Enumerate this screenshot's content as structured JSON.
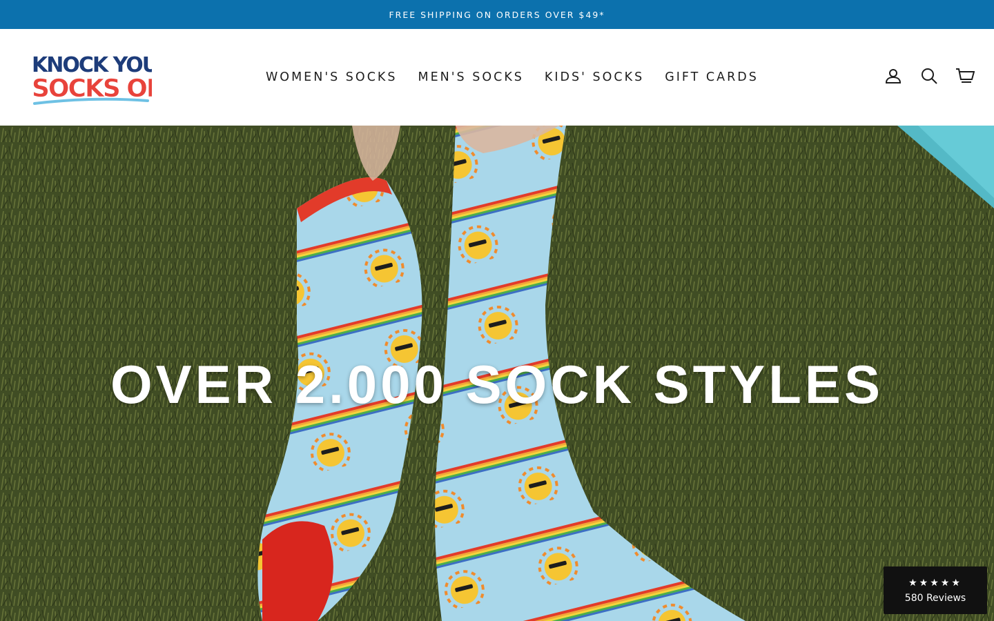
{
  "announcement": {
    "text": "FREE SHIPPING ON ORDERS OVER $49*"
  },
  "brand": {
    "line1": "KNOCK YOUR",
    "line2": "SOCKS OFF"
  },
  "nav": {
    "items": [
      {
        "label": "WOMEN'S SOCKS"
      },
      {
        "label": "MEN'S SOCKS"
      },
      {
        "label": "KIDS' SOCKS"
      },
      {
        "label": "GIFT CARDS"
      }
    ]
  },
  "header_icons": [
    "user-icon",
    "search-icon",
    "cart-icon"
  ],
  "hero": {
    "title": "OVER 2.000 SOCK STYLES"
  },
  "reviews_badge": {
    "stars": "★★★★★",
    "rating": 4.5,
    "count_label": "580 Reviews"
  },
  "colors": {
    "announcement_bg": "#0c71ad",
    "logo_blue": "#1d3c7a",
    "logo_red": "#e8433b",
    "badge_bg": "#111111"
  }
}
